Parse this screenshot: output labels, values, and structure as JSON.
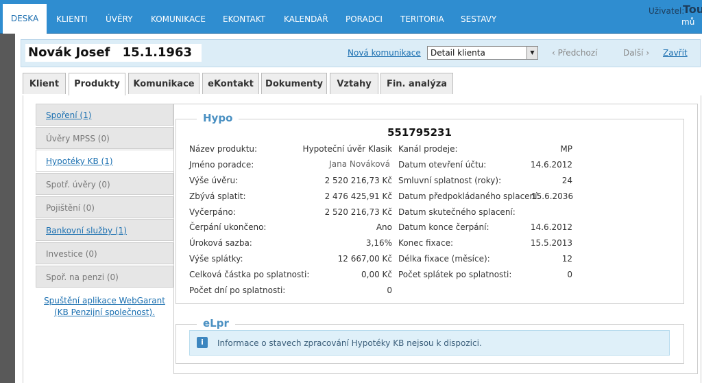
{
  "nav": {
    "items": [
      "DESKA",
      "KLIENTI",
      "ÚVĚRY",
      "KOMUNIKACE",
      "EKONTAKT",
      "KALENDÁŘ",
      "PORADCI",
      "TERITORIA",
      "SESTAVY"
    ],
    "active": "DESKA"
  },
  "user": {
    "label": "Uživatel:",
    "name": "Tou",
    "sub": "mů"
  },
  "header": {
    "client_name": "Novák Josef",
    "birth_date": "15.1.1963",
    "new_communication": "Nová komunikace",
    "view_select": "Detail klienta",
    "prev": "‹ Předchozí",
    "next": "Další ›",
    "close": "Zavřít"
  },
  "tabs": [
    "Klient",
    "Produkty",
    "Komunikace",
    "eKontakt",
    "Dokumenty",
    "Vztahy",
    "Fin. analýza"
  ],
  "active_tab": "Produkty",
  "sidemenu": {
    "items": [
      {
        "label": "Spoření (1)",
        "link": true
      },
      {
        "label": "Úvěry MPSS (0)",
        "link": false
      },
      {
        "label": "Hypotéky KB (1)",
        "link": true,
        "active": true
      },
      {
        "label": "Spotř. úvěry (0)",
        "link": false
      },
      {
        "label": "Pojištění (0)",
        "link": false
      },
      {
        "label": "Bankovní služby (1)",
        "link": true
      },
      {
        "label": "Investice (0)",
        "link": false
      },
      {
        "label": "Spoř. na penzi (0)",
        "link": false
      }
    ],
    "footer_line1": "Spuštění aplikace WebGarant",
    "footer_line2": "(KB Penzijní společnost)."
  },
  "hypo": {
    "title": "Hypo",
    "account": "551795231",
    "left": [
      {
        "label": "Název produktu:",
        "value": "Hypoteční úvěr Klasik"
      },
      {
        "label": "Jméno poradce:",
        "value": "Jana Nováková"
      },
      {
        "label": "Výše úvěru:",
        "value": "2 520 216,73 Kč"
      },
      {
        "label": "Zbývá splatit:",
        "value": "2 476 425,91 Kč"
      },
      {
        "label": "Vyčerpáno:",
        "value": "2 520 216,73 Kč"
      },
      {
        "label": "Čerpání ukončeno:",
        "value": "Ano"
      },
      {
        "label": "Úroková sazba:",
        "value": "3,16%"
      },
      {
        "label": "Výše splátky:",
        "value": "12 667,00 Kč"
      },
      {
        "label": "Celková částka po splatnosti:",
        "value": "0,00 Kč"
      },
      {
        "label": "Počet dní po splatnosti:",
        "value": "0"
      }
    ],
    "right": [
      {
        "label": "Kanál prodeje:",
        "value": "MP"
      },
      {
        "label": "Datum otevření účtu:",
        "value": "14.6.2012"
      },
      {
        "label": "Smluvní splatnost (roky):",
        "value": "24"
      },
      {
        "label": "Datum předpokládaného splacení:",
        "value": "15.6.2036"
      },
      {
        "label": "Datum skutečného splacení:",
        "value": ""
      },
      {
        "label": "Datum konce čerpání:",
        "value": "14.6.2012"
      },
      {
        "label": "Konec fixace:",
        "value": "15.5.2013"
      },
      {
        "label": "Délka fixace (měsíce):",
        "value": "12"
      },
      {
        "label": "Počet splátek po splatnosti:",
        "value": "0"
      }
    ]
  },
  "elpr": {
    "title": "eLpr",
    "icon": "info-icon",
    "message": "Informace o stavech zpracování Hypotéky KB nejsou k dispozici."
  }
}
